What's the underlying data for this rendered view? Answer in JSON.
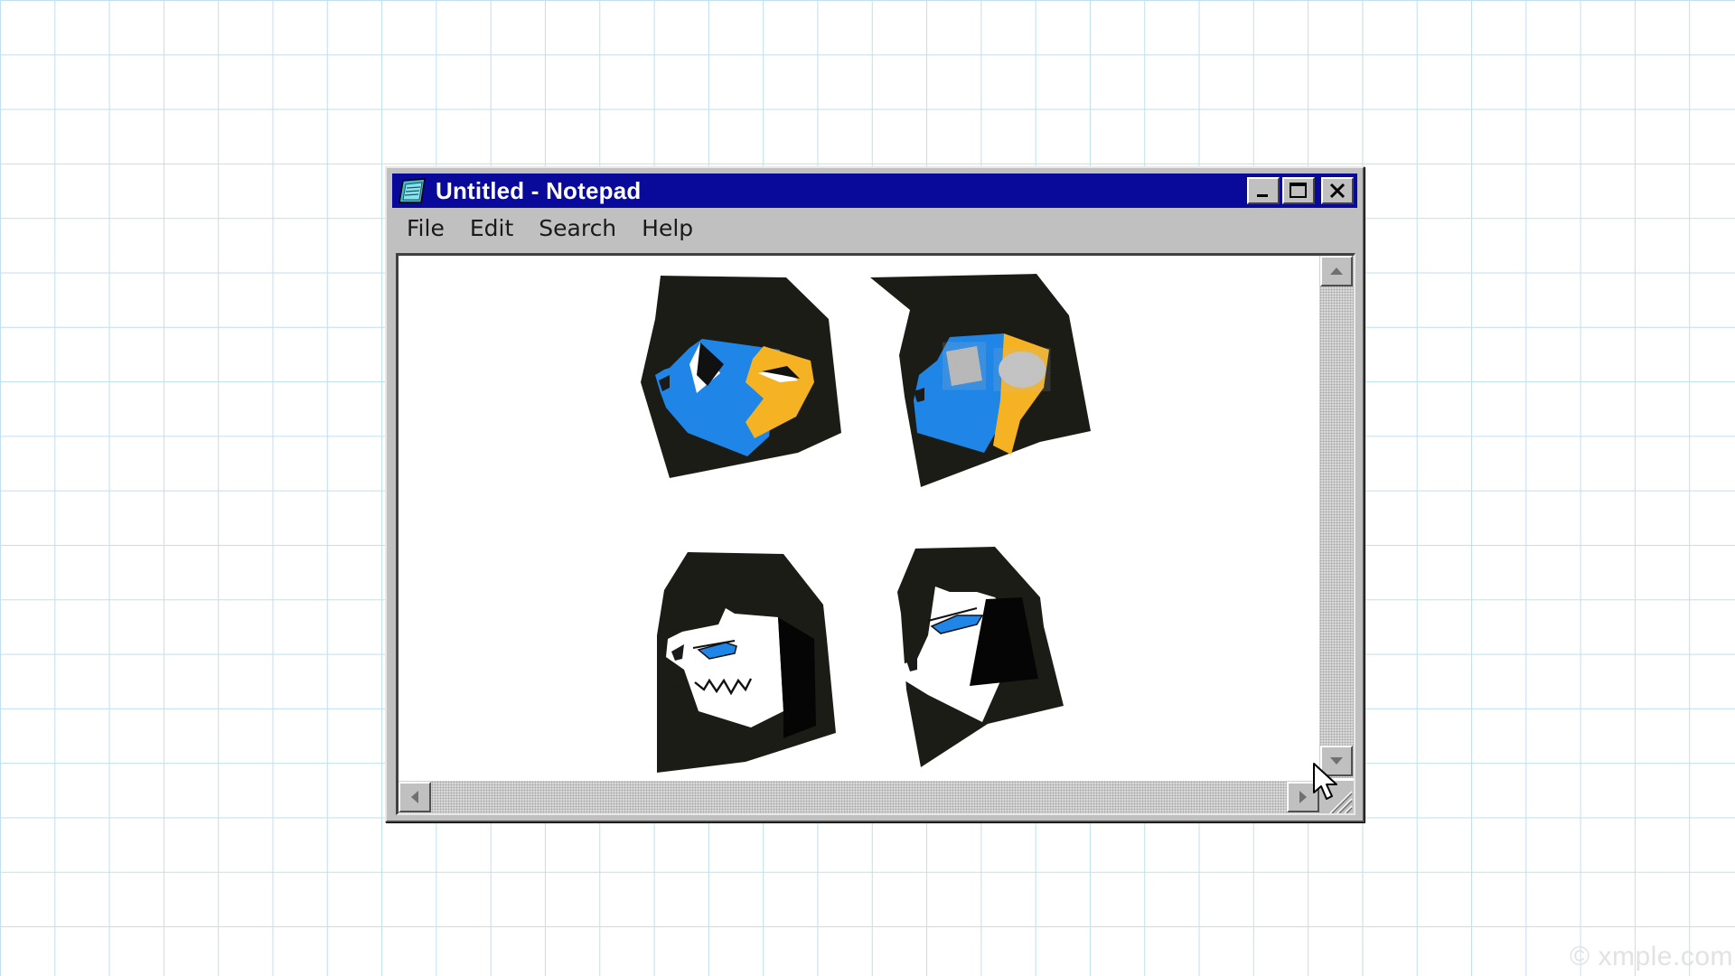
{
  "window": {
    "title": "Untitled - Notepad",
    "app_icon": "notepad-icon",
    "controls": {
      "minimize": "minimize-icon",
      "maximize": "maximize-icon",
      "close": "close-icon"
    }
  },
  "menu": {
    "items": [
      {
        "label": "File"
      },
      {
        "label": "Edit"
      },
      {
        "label": "Search"
      },
      {
        "label": "Help"
      }
    ]
  },
  "content": {
    "type": "image",
    "description_icons": [
      "face-drawing-1",
      "face-drawing-2",
      "face-drawing-3",
      "face-drawing-4"
    ]
  },
  "scrollbars": {
    "up_arrow": "arrow-up-icon",
    "down_arrow": "arrow-down-icon",
    "left_arrow": "arrow-left-icon",
    "right_arrow": "arrow-right-icon"
  },
  "watermark": "© xmple.com",
  "colors": {
    "titlebar": "#0a0a9a",
    "face_blue": "#1f86e8",
    "face_yellow": "#f5b324",
    "hair": "#1d1b14",
    "chrome": "#c0c0c0",
    "grid_line": "#bfe0ec"
  }
}
